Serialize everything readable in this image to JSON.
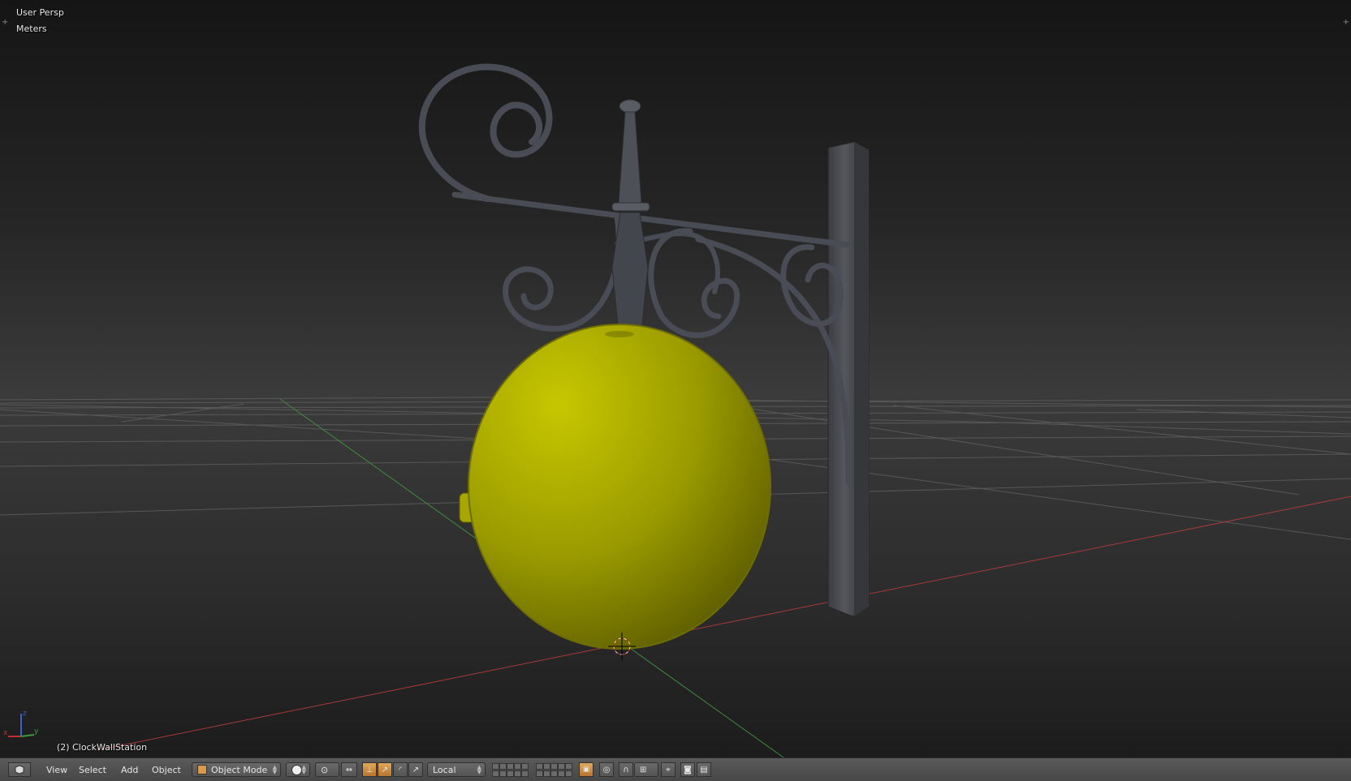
{
  "viewport": {
    "view_name": "User Persp",
    "units": "Meters",
    "object_info": "(2) ClockWallStation",
    "axis_labels": {
      "x": "x",
      "y": "y",
      "z": "z"
    }
  },
  "header": {
    "editor_type_icon": "3d-view-icon",
    "menus": [
      "View",
      "Select",
      "Add",
      "Object"
    ],
    "mode_label": "Object Mode",
    "shading_icon": "solid-shading-icon",
    "pivot_icon": "pivot-point-icon",
    "orientation_label": "Local",
    "colors": {
      "accent": "#d99a4a",
      "clock_body": "#b8b800",
      "bracket": "#4a4c52"
    }
  }
}
